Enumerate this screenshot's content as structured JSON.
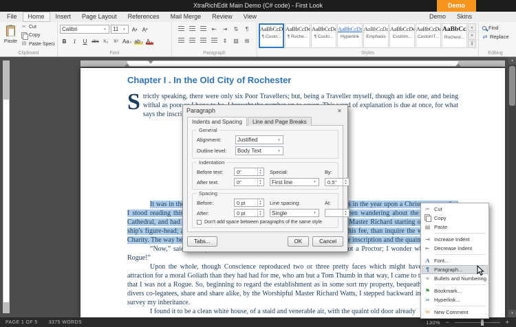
{
  "titlebar": {
    "title": "XtraRichEdit Main Demo (C# code) - First Look",
    "demo_badge": "Demo"
  },
  "ribbon": {
    "tabs": [
      {
        "label": "File",
        "name": "tab-file"
      },
      {
        "label": "Home",
        "name": "tab-home",
        "state": "active"
      },
      {
        "label": "Insert",
        "name": "tab-insert"
      },
      {
        "label": "Page Layout",
        "name": "tab-page-layout"
      },
      {
        "label": "References",
        "name": "tab-references"
      },
      {
        "label": "Mail Merge",
        "name": "tab-mail-merge"
      },
      {
        "label": "Review",
        "name": "tab-review"
      },
      {
        "label": "View",
        "name": "tab-view"
      }
    ],
    "right_tabs": [
      {
        "label": "Demo",
        "name": "tab-demo"
      },
      {
        "label": "Skins",
        "name": "tab-skins"
      }
    ],
    "clipboard": {
      "group_label": "Clipboard",
      "paste_label": "Paste",
      "small_buttons": [
        {
          "label": "Cut",
          "name": "cut-button",
          "glyph": "✂",
          "cls": ""
        },
        {
          "label": "Copy",
          "name": "copy-button",
          "glyph": "",
          "cls": "ic-copy"
        },
        {
          "label": "Paste Special",
          "name": "paste-special-button",
          "glyph": "▤",
          "cls": ""
        }
      ]
    },
    "font": {
      "group_label": "Font",
      "font_name": "Calibri",
      "font_size": "11",
      "row1_buttons": [
        {
          "name": "grow-font-button",
          "glyph": "A",
          "cls": "grow"
        },
        {
          "name": "shrink-font-button",
          "glyph": "A",
          "cls": "shrink"
        }
      ],
      "buttons": [
        {
          "name": "bold-button",
          "glyph": "B",
          "cls": "fb-b"
        },
        {
          "name": "italic-button",
          "glyph": "I",
          "cls": "fb-i"
        },
        {
          "name": "underline-button",
          "glyph": "U",
          "cls": "fb-u"
        },
        {
          "name": "strikethrough-button",
          "glyph": "abc",
          "cls": "fb-s"
        },
        {
          "name": "subscript-button",
          "glyph": "X₂",
          "cls": "fb-sub"
        },
        {
          "name": "superscript-button",
          "glyph": "X²",
          "cls": "fb-sup"
        },
        {
          "name": "change-case-button",
          "glyph": "Aa",
          "cls": "dd"
        },
        {
          "name": "highlight-color-button",
          "glyph": "ab",
          "cls": "dd hl2"
        },
        {
          "name": "font-color-button",
          "glyph": "A",
          "cls": "dd fc"
        }
      ]
    },
    "paragraph": {
      "group_label": "Paragraph",
      "row1": [
        {
          "name": "bullets-icon",
          "type": "bars"
        },
        {
          "name": "numbering-icon",
          "type": "bars"
        },
        {
          "name": "multilevel-list-icon",
          "type": "bars"
        },
        {
          "name": "decrease-indent-icon",
          "glyph": "⇤"
        },
        {
          "name": "increase-indent-icon",
          "glyph": "⇥"
        },
        {
          "name": "sort-icon",
          "glyph": "⇅"
        },
        {
          "name": "show-marks-icon",
          "glyph": "¶"
        }
      ],
      "row2": [
        {
          "name": "align-left-icon",
          "type": "bars"
        },
        {
          "name": "align-center-icon",
          "type": "bars"
        },
        {
          "name": "align-right-icon",
          "type": "bars"
        },
        {
          "name": "align-justify-icon",
          "type": "bars"
        },
        {
          "name": "line-spacing-icon",
          "glyph": "⇕"
        },
        {
          "name": "shading-icon",
          "glyph": "▨"
        },
        {
          "name": "borders-icon",
          "glyph": "⊞"
        }
      ]
    },
    "styles": {
      "group_label": "Styles",
      "items": [
        {
          "sample": "AaBbCcDdE",
          "label": "¶ Custo...",
          "state": "selected",
          "sample_cls": ""
        },
        {
          "sample": "AaBbCcDdE",
          "label": "¶ Roche...",
          "state": "",
          "sample_cls": ""
        },
        {
          "sample": "AaBbCcDdE",
          "label": "¶ Custo...",
          "state": "",
          "sample_cls": ""
        },
        {
          "sample": "AaBbCcDd",
          "label": "Hyperlink",
          "state": "",
          "sample_cls": "hyp"
        },
        {
          "sample": "AaBbCcDd",
          "label": "Emphasis",
          "state": "",
          "sample_cls": "emp"
        },
        {
          "sample": "AaBbCcDdE",
          "label": "Custom...",
          "state": "",
          "sample_cls": ""
        },
        {
          "sample": "AaBbCcDdE",
          "label": "CustomT...",
          "state": "",
          "sample_cls": ""
        },
        {
          "sample": "AaBbCcD",
          "label": "Rochest...",
          "state": "",
          "sample_cls": "big"
        }
      ]
    },
    "editing": {
      "group_label": "Editing",
      "find_label": "Find",
      "replace_label": "Replace"
    }
  },
  "document": {
    "heading": "Chapter I . In the Old City of Rochester",
    "dropcap": "S",
    "para1": "trictly speaking, there were only six Poor Travellers; but, being a Traveller myself, though an idle one, and being withal as poor as I hope to be, I brought the number up to seven. This word of explanation is due at once, for what says the inscription over the quaint old door?",
    "para2_selected": "It was in the ancient little city of Rochester in Kent, of all the good days in the year upon a Christmas-eve, that I stood reading this inscription over the quaint old door in question. I had been wandering about the neighbouring Cathedral, and had seen the tomb of Richard Watts, with the effigy of worthy Master Richard starting out of it like a ship's figure-head; and I had felt that I could do no less, as I gave the Verger his fee, than inquire the way to Watts's Charity. The way being very short and very plain, I had come prosperously to the inscription and the quaint old door.",
    "para3": "“Now,” said I to myself, as I looked at the knocker, “I know I am not a Proctor; I wonder whether I am a Rogue!”",
    "para4": "Upon the whole, though Conscience reproduced two or three pretty faces which might have had smaller attraction for a moral Goliath than they had had for me, who am but a Tom Thumb in that way, I came to the conclusion that I was not a Rogue. So, beginning to regard the establishment as in some sort my property, bequeathed to me and divers co-legatees, share and share alike, by the Worshipful Master Richard Watts, I stepped backward into the road to survey my inheritance.",
    "para5": "I found it to be a clean white house, of a staid and venerable air, with the quaint old door already"
  },
  "dialog": {
    "title": "Paragraph",
    "tabs": [
      {
        "label": "Indents and Spacing",
        "name": "dialog-tab-indents-and-spacing",
        "state": "active"
      },
      {
        "label": "Line and Page Breaks",
        "name": "dialog-tab-line-and-page-breaks",
        "state": ""
      }
    ],
    "general": {
      "label": "General",
      "alignment_label": "Alignment:",
      "alignment_value": "Justified",
      "outline_label": "Outline level:",
      "outline_value": "Body Text"
    },
    "indentation": {
      "label": "Indentation",
      "before_label": "Before text:",
      "before_value": "0\"",
      "after_label": "After text:",
      "after_value": "0\"",
      "special_label": "Special:",
      "special_value": "First line",
      "by_label": "By:",
      "by_value": "0.5\""
    },
    "spacing": {
      "label": "Spacing",
      "before_label": "Before:",
      "before_value": "0 pt",
      "after_label": "After:",
      "after_value": "0 pt",
      "line_spacing_label": "Line spacing:",
      "line_spacing_value": "Single",
      "at_label": "At:",
      "at_value": "",
      "checkbox_label": "Don't add space between paragraphs of the same style"
    },
    "buttons": {
      "tabs": "Tabs...",
      "ok": "OK",
      "cancel": "Cancel"
    }
  },
  "context_menu": {
    "items": [
      {
        "label": "Cut",
        "glyph": "✂",
        "name": "menu-item-cut",
        "icon_name": "cut-icon",
        "state": "",
        "icon_cls": ""
      },
      {
        "label": "Copy",
        "glyph": "",
        "name": "menu-item-copy",
        "icon_name": "copy-icon",
        "state": "",
        "icon_cls": "ic-copy"
      },
      {
        "label": "Paste",
        "glyph": "▤",
        "name": "menu-item-paste",
        "icon_name": "paste-icon",
        "state": "",
        "icon_cls": ""
      },
      {
        "state": "sep"
      },
      {
        "label": "Increase Indent",
        "glyph": "⇥",
        "name": "menu-item-increase-indent",
        "icon_name": "increase-indent-icon",
        "state": "",
        "icon_cls": ""
      },
      {
        "label": "Decrease Indent",
        "glyph": "⇤",
        "name": "menu-item-decrease-indent",
        "icon_name": "decrease-indent-icon",
        "state": "",
        "icon_cls": ""
      },
      {
        "state": "sep"
      },
      {
        "label": "Font...",
        "glyph": "A",
        "name": "menu-item-font",
        "icon_name": "font-icon",
        "state": "",
        "icon_cls": "ic-font"
      },
      {
        "label": "Paragraph...",
        "glyph": "¶",
        "name": "menu-item-paragraph",
        "icon_name": "paragraph-icon",
        "state": "hover",
        "icon_cls": "ic-para"
      },
      {
        "label": "Bullets and Numbering...",
        "glyph": "≡",
        "name": "menu-item-bullets-and-numbering",
        "icon_name": "bullets-icon",
        "state": "",
        "icon_cls": ""
      },
      {
        "state": "sep"
      },
      {
        "label": "Bookmark...",
        "glyph": "⚑",
        "name": "menu-item-bookmark",
        "icon_name": "bookmark-icon",
        "state": "",
        "icon_cls": "ic-book"
      },
      {
        "label": "Hyperlink...",
        "glyph": "∞",
        "name": "menu-item-hyperlink",
        "icon_name": "hyperlink-icon",
        "state": "",
        "icon_cls": "ic-link"
      },
      {
        "state": "sep"
      },
      {
        "label": "New Comment",
        "glyph": "✉",
        "name": "menu-item-new-comment",
        "icon_name": "comment-icon",
        "state": "",
        "icon_cls": "ic-comment"
      }
    ]
  },
  "statusbar": {
    "page": "PAGE 1 OF 5",
    "words": "3375 WORDS",
    "zoom": "130%"
  }
}
